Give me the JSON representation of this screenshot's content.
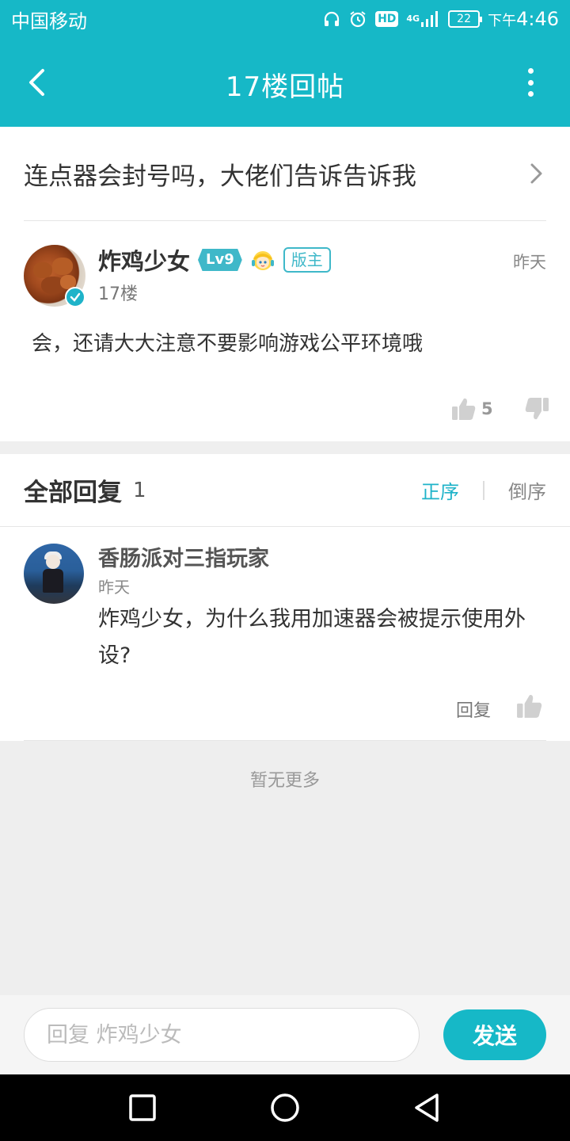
{
  "status_bar": {
    "carrier": "中国移动",
    "hd": "HD",
    "network": "4G",
    "battery": "22",
    "time_prefix": "下午",
    "time": "4:46"
  },
  "app_bar": {
    "title": "17楼回帖"
  },
  "topic": {
    "title": "连点器会封号吗，大佬们告诉告诉我"
  },
  "post": {
    "author": "炸鸡少女",
    "level": "Lv9",
    "role": "版主",
    "time": "昨天",
    "floor": "17楼",
    "content": "会，还请大大注意不要影响游戏公平环境哦",
    "likes": "5"
  },
  "replies_header": {
    "title": "全部回复",
    "count": "1",
    "sort_asc": "正序",
    "sort_desc": "倒序"
  },
  "replies": [
    {
      "author": "香肠派对三指玩家",
      "time": "昨天",
      "text": "炸鸡少女，为什么我用加速器会被提示使用外设?",
      "reply_label": "回复"
    }
  ],
  "footer": {
    "no_more": "暂无更多"
  },
  "input_bar": {
    "placeholder": "回复 炸鸡少女",
    "send_label": "发送"
  },
  "colors": {
    "accent": "#16b8c7",
    "level_badge": "#3fb8c9"
  }
}
